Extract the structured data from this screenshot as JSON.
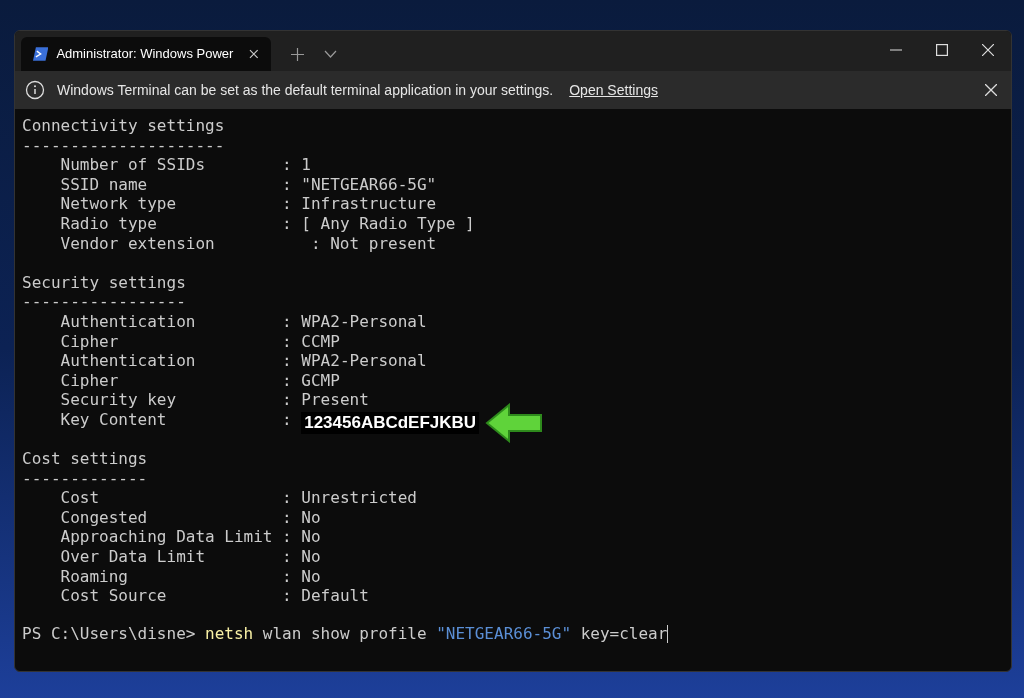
{
  "tab": {
    "title": "Administrator: Windows Power",
    "selected": true
  },
  "infobar": {
    "message": "Windows Terminal can be set as the default terminal application in your settings.",
    "link": "Open Settings"
  },
  "sections": [
    {
      "heading": "Connectivity settings",
      "rule": "---------------------",
      "rows": [
        {
          "label": "Number of SSIDs",
          "colon": ":",
          "value": "1"
        },
        {
          "label": "SSID name",
          "colon": ":",
          "value": "\"NETGEAR66-5G\""
        },
        {
          "label": "Network type",
          "colon": ":",
          "value": "Infrastructure"
        },
        {
          "label": "Radio type",
          "colon": ":",
          "value": "[ Any Radio Type ]"
        },
        {
          "label": "Vendor extension",
          "colon": ":",
          "value": "Not present",
          "kind": "offset"
        }
      ]
    },
    {
      "heading": "Security settings",
      "rule": "-----------------",
      "rows": [
        {
          "label": "Authentication",
          "colon": ":",
          "value": "WPA2-Personal"
        },
        {
          "label": "Cipher",
          "colon": ":",
          "value": "CCMP"
        },
        {
          "label": "Authentication",
          "colon": ":",
          "value": "WPA2-Personal"
        },
        {
          "label": "Cipher",
          "colon": ":",
          "value": "GCMP"
        },
        {
          "label": "Security key",
          "colon": ":",
          "value": "Present"
        },
        {
          "label": "Key Content",
          "colon": ":",
          "value": "123456ABCdEFJKBU",
          "kind": "highlight"
        }
      ]
    },
    {
      "heading": "Cost settings",
      "rule": "-------------",
      "rows": [
        {
          "label": "Cost",
          "colon": ":",
          "value": "Unrestricted"
        },
        {
          "label": "Congested",
          "colon": ":",
          "value": "No"
        },
        {
          "label": "Approaching Data Limit",
          "colon": ":",
          "value": "No"
        },
        {
          "label": "Over Data Limit",
          "colon": ":",
          "value": "No"
        },
        {
          "label": "Roaming",
          "colon": ":",
          "value": "No"
        },
        {
          "label": "Cost Source",
          "colon": ":",
          "value": "Default"
        }
      ]
    }
  ],
  "prompt": {
    "path": "PS C:\\Users\\disne>",
    "command": "netsh",
    "args": "wlan show profile",
    "string": "\"NETGEAR66-5G\"",
    "tail": "key=clear"
  }
}
